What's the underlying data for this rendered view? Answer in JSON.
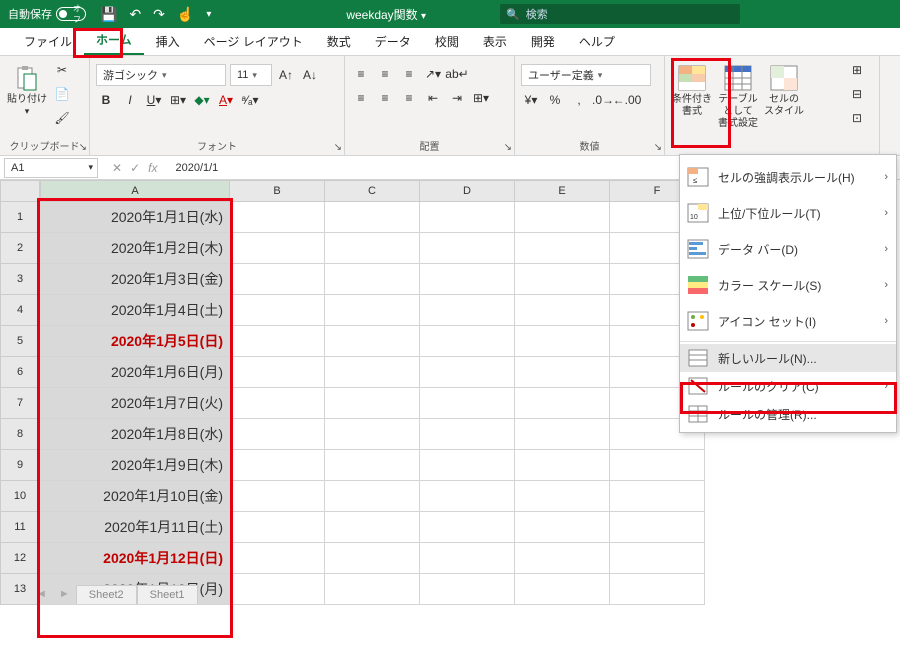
{
  "titlebar": {
    "autosave_label": "自動保存",
    "autosave_state": "オフ",
    "filename": "weekday関数",
    "search_placeholder": "検索"
  },
  "tabs": [
    "ファイル",
    "ホーム",
    "挿入",
    "ページ レイアウト",
    "数式",
    "データ",
    "校閲",
    "表示",
    "開発",
    "ヘルプ"
  ],
  "active_tab": 1,
  "ribbon": {
    "clipboard": {
      "label": "クリップボード",
      "paste": "貼り付け"
    },
    "font": {
      "label": "フォント",
      "name": "游ゴシック",
      "size": "11"
    },
    "align": {
      "label": "配置"
    },
    "number": {
      "label": "数値",
      "format": "ユーザー定義"
    },
    "styles": {
      "cond": "条件付き\n書式",
      "table": "テーブルとして\n書式設定",
      "cell": "セルの\nスタイル"
    }
  },
  "formula_bar": {
    "cellref": "A1",
    "value": "2020/1/1"
  },
  "columns": [
    "A",
    "B",
    "C",
    "D",
    "E",
    "F"
  ],
  "rows": [
    {
      "n": 1,
      "a": "2020年1月1日(水)",
      "red": false
    },
    {
      "n": 2,
      "a": "2020年1月2日(木)",
      "red": false
    },
    {
      "n": 3,
      "a": "2020年1月3日(金)",
      "red": false
    },
    {
      "n": 4,
      "a": "2020年1月4日(土)",
      "red": false
    },
    {
      "n": 5,
      "a": "2020年1月5日(日)",
      "red": true
    },
    {
      "n": 6,
      "a": "2020年1月6日(月)",
      "red": false
    },
    {
      "n": 7,
      "a": "2020年1月7日(火)",
      "red": false
    },
    {
      "n": 8,
      "a": "2020年1月8日(水)",
      "red": false
    },
    {
      "n": 9,
      "a": "2020年1月9日(木)",
      "red": false
    },
    {
      "n": 10,
      "a": "2020年1月10日(金)",
      "red": false
    },
    {
      "n": 11,
      "a": "2020年1月11日(土)",
      "red": false
    },
    {
      "n": 12,
      "a": "2020年1月12日(日)",
      "red": true
    },
    {
      "n": 13,
      "a": "2020年1月13日(月)",
      "red": false
    }
  ],
  "sheets": [
    "Sheet2",
    "Sheet1"
  ],
  "menu": {
    "highlight": "セルの強調表示ルール(H)",
    "top": "上位/下位ルール(T)",
    "databar": "データ バー(D)",
    "colorscale": "カラー スケール(S)",
    "iconset": "アイコン セット(I)",
    "newrule": "新しいルール(N)...",
    "clear": "ルールのクリア(C)",
    "manage": "ルールの管理(R)..."
  }
}
